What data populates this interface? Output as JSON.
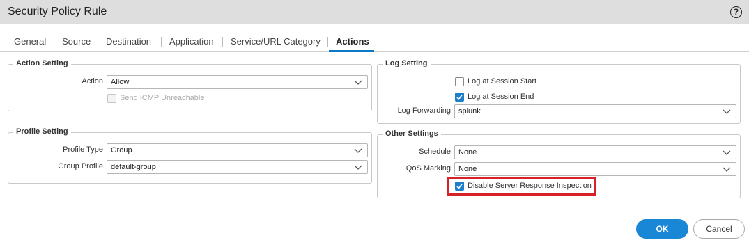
{
  "dialog": {
    "title": "Security Policy Rule",
    "help_icon_text": "?"
  },
  "tabs": [
    {
      "label": "General"
    },
    {
      "label": "Source"
    },
    {
      "label": "Destination"
    },
    {
      "label": "Application"
    },
    {
      "label": "Service/URL Category"
    },
    {
      "label": "Actions",
      "active": true
    }
  ],
  "action_setting": {
    "legend": "Action Setting",
    "action_label": "Action",
    "action_value": "Allow",
    "send_icmp_label": "Send ICMP Unreachable",
    "send_icmp_checked": false,
    "send_icmp_disabled": true
  },
  "profile_setting": {
    "legend": "Profile Setting",
    "profile_type_label": "Profile Type",
    "profile_type_value": "Group",
    "group_profile_label": "Group Profile",
    "group_profile_value": "default-group"
  },
  "log_setting": {
    "legend": "Log Setting",
    "log_start_label": "Log at Session Start",
    "log_start_checked": false,
    "log_end_label": "Log at Session End",
    "log_end_checked": true,
    "log_forwarding_label": "Log Forwarding",
    "log_forwarding_value": "splunk"
  },
  "other_settings": {
    "legend": "Other Settings",
    "schedule_label": "Schedule",
    "schedule_value": "None",
    "qos_label": "QoS Marking",
    "qos_value": "None",
    "disable_sri_label": "Disable Server Response Inspection",
    "disable_sri_checked": true
  },
  "buttons": {
    "ok": "OK",
    "cancel": "Cancel"
  },
  "colors": {
    "accent": "#1a86d6",
    "highlight": "#d6202a",
    "titlebar": "#dedede"
  },
  "icons": {
    "help": "help-circle-icon",
    "dropdown": "chevron-down-icon",
    "check": "checkmark-icon"
  }
}
